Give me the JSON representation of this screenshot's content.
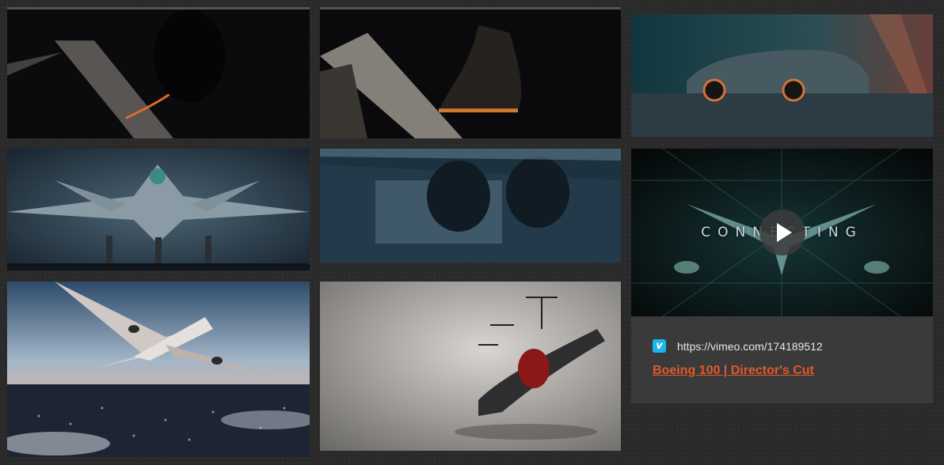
{
  "gallery": {
    "tiles": [
      {
        "name": "shoe-closeup-dark",
        "icon": "image"
      },
      {
        "name": "shoe-on-ramp",
        "icon": "image"
      },
      {
        "name": "sports-car",
        "icon": "image"
      },
      {
        "name": "fighter-jet-front",
        "icon": "image"
      },
      {
        "name": "jet-engines",
        "icon": "image"
      },
      {
        "name": "airliner-over-city",
        "icon": "image"
      },
      {
        "name": "evtol-aircraft",
        "icon": "image"
      }
    ]
  },
  "video_card": {
    "overlay_text": "CONNECTING",
    "provider_icon": "vimeo-icon",
    "provider_letter": "v",
    "url": "https://vimeo.com/174189512",
    "title": "Boeing 100 | Director's Cut",
    "colors": {
      "title": "#e2582b",
      "vimeo": "#1ab7ea"
    }
  }
}
